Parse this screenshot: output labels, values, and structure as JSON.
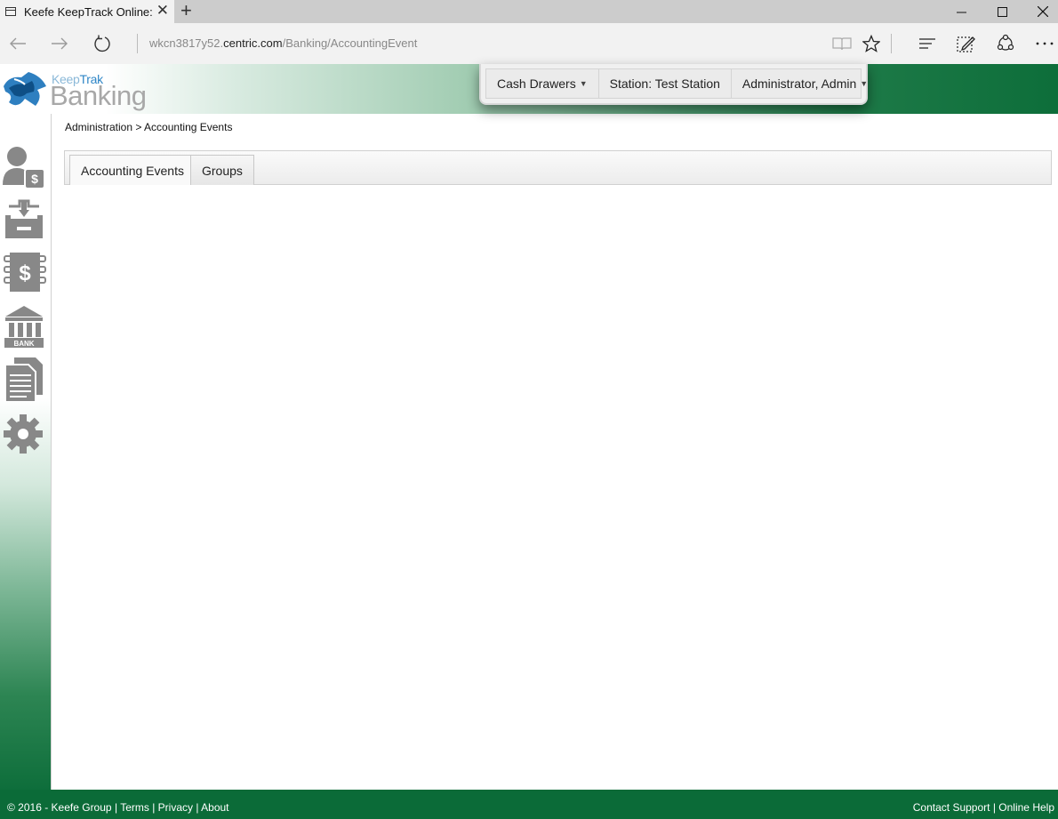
{
  "browser": {
    "tab_title": "Keefe KeepTrack Online:",
    "url_prefix": "wkcn3817y52.",
    "url_domain": "centric.com",
    "url_path": "/Banking/AccountingEvent"
  },
  "app": {
    "logo_keep": "Keep",
    "logo_trak": "Trak",
    "logo_banking": "Banking",
    "top_menu": {
      "cash_drawers": "Cash Drawers",
      "station": "Station: Test Station",
      "user": "Administrator, Admin"
    },
    "sidebar_icons": [
      "customer-dollar-icon",
      "cash-drawer-icon",
      "ledger-dollar-icon",
      "bank-icon",
      "reports-icon",
      "settings-gear-icon"
    ],
    "bank_label": "BANK",
    "breadcrumb": "Administration > Accounting Events",
    "tabs": [
      {
        "label": "Accounting Events"
      },
      {
        "label": "Groups"
      }
    ],
    "footer": {
      "copyright": "© 2016 - Keefe Group",
      "terms": "Terms",
      "privacy": "Privacy",
      "about": "About",
      "contact": "Contact Support",
      "help": "Online Help",
      "sep": "|"
    }
  }
}
